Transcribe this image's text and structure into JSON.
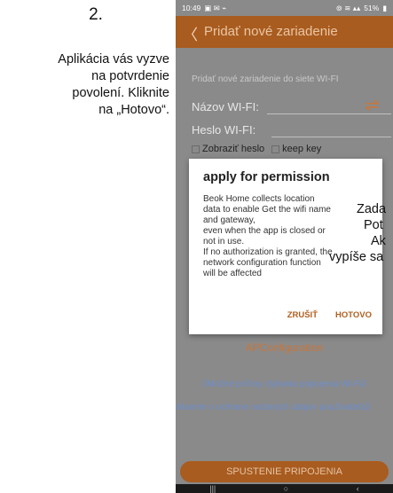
{
  "instructions": {
    "step_number": "2.",
    "text": "Aplikácia vás vyzve\nna potvrdenie\npovolení. Kliknite\nna „Hotovo“."
  },
  "status_bar": {
    "time": "10:49",
    "battery": "51%"
  },
  "app_bar": {
    "back_icon": "chevron-left",
    "title": "Pridať nové zariadenie"
  },
  "form": {
    "subtitle": "Pridať nové zariadenie do siete WI-FI",
    "wifi_name_label": "Názov WI-FI:",
    "wifi_password_label": "Heslo WI-FI:",
    "swap_icon": "swap-arrows",
    "checkboxes": [
      "Zobraziť heslo",
      "keep key"
    ]
  },
  "dialog": {
    "title": "apply for permission",
    "body": "Beok Home collects location\ndata to enable Get the wifi name\nand gateway,\n even when the app is closed or\nnot in use.\n If no authorization is granted, the\nnetwork configuration function\nwill be affected",
    "cancel_label": "ZRUŠIŤ",
    "ok_label": "HOTOVO"
  },
  "overlay_text": [
    "Zada",
    "Pot",
    "Ak",
    "vypíše sa"
  ],
  "ap_configuration": "APConfiguration",
  "links": {
    "failure_reasons": "《Možné príčiny zlyhania pripojenia Wi-Fi》",
    "privacy_notice": "《Vyhlásenie o ochrane osobných údajov používateľa》"
  },
  "start_button": "SPUSTENIE PRIPOJENIA",
  "nav_bar": {
    "icons": [
      "recent-apps-icon",
      "home-icon",
      "back-icon"
    ]
  },
  "colors": {
    "accent": "#a95c1f",
    "link": "#6d8fd0",
    "dim_background": "#8a8a8a"
  }
}
